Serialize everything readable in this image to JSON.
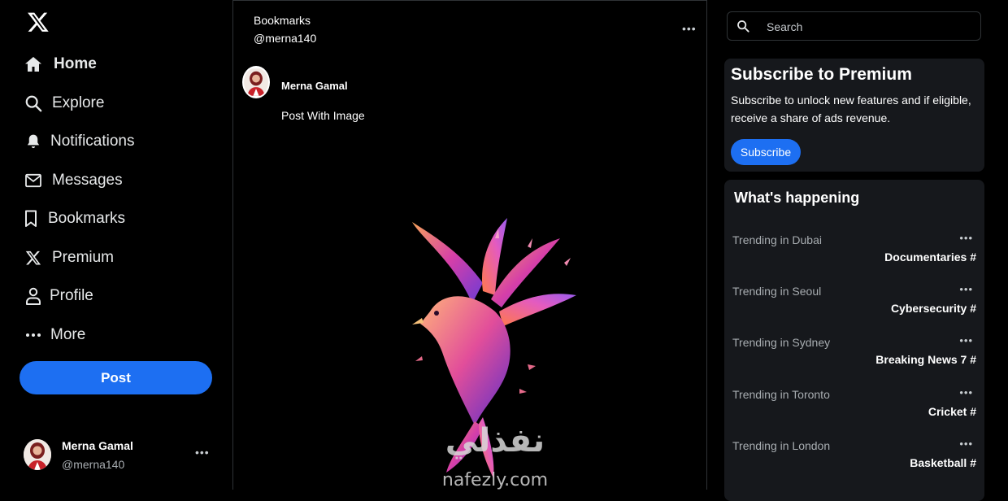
{
  "sidebar": {
    "logo": "x-logo-icon",
    "items": [
      {
        "label": "Home",
        "icon": "home-icon"
      },
      {
        "label": "Explore",
        "icon": "search-icon"
      },
      {
        "label": "Notifications",
        "icon": "bell-icon"
      },
      {
        "label": "Messages",
        "icon": "envelope-icon"
      },
      {
        "label": "Bookmarks",
        "icon": "bookmark-icon"
      },
      {
        "label": "Premium",
        "icon": "x-icon"
      },
      {
        "label": "Profile",
        "icon": "person-icon"
      },
      {
        "label": "More",
        "icon": "more-dots-icon"
      }
    ],
    "post_label": "Post",
    "account": {
      "name": "Merna Gamal",
      "handle": "@merna140",
      "more": "•••"
    }
  },
  "main": {
    "title": "Bookmarks",
    "handle": "@merna140",
    "more": "•••",
    "post": {
      "author": "Merna Gamal",
      "text": "Post With Image",
      "image_watermark_arabic": "نفذلي",
      "image_watermark_latin": "nafezly.com"
    }
  },
  "right": {
    "search_placeholder": "Search",
    "premium": {
      "title": "Subscribe to Premium",
      "description": "Subscribe to unlock new features and if eligible, receive a share of ads revenue.",
      "button": "Subscribe"
    },
    "happening": {
      "title": "What's happening",
      "trends": [
        {
          "location": "Trending in Dubai",
          "topic": "Documentaries #",
          "more": "•••"
        },
        {
          "location": "Trending in Seoul",
          "topic": "Cybersecurity #",
          "more": "•••"
        },
        {
          "location": "Trending in Sydney",
          "topic": "Breaking News 7 #",
          "more": "•••"
        },
        {
          "location": "Trending in Toronto",
          "topic": "Cricket #",
          "more": "•••"
        },
        {
          "location": "Trending in London",
          "topic": "Basketball #",
          "more": "•••"
        }
      ]
    }
  },
  "colors": {
    "accent": "#1d6ff2",
    "background": "#000000",
    "card": "#16181c"
  }
}
